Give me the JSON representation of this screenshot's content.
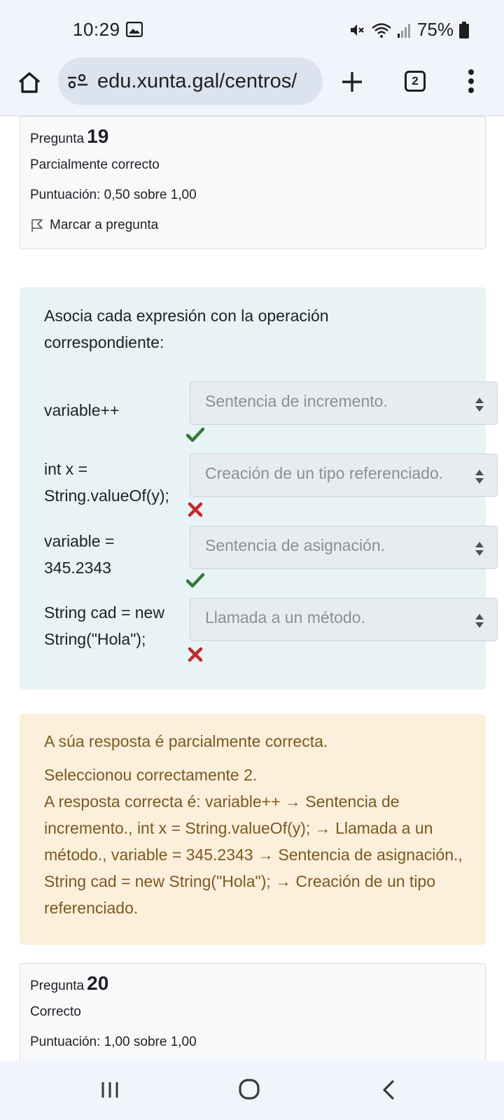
{
  "status_bar": {
    "time": "10:29",
    "battery": "75%",
    "icons": [
      "photo-icon",
      "mute-icon",
      "wifi-icon",
      "signal-icon",
      "battery-icon"
    ]
  },
  "browser": {
    "url": "edu.xunta.gal/centros/",
    "tab_count": "2",
    "icons": [
      "home-icon",
      "site-settings-icon",
      "plus-icon",
      "tabs-icon",
      "overflow-menu-icon"
    ]
  },
  "question19": {
    "label": "Pregunta",
    "number": "19",
    "state": "Parcialmente correcto",
    "grade": "Puntuación: 0,50 sobre 1,00",
    "flag_label": "Marcar a pregunta",
    "text_line1": "Asocia cada expresión con la operación",
    "text_line2": "correspondiente:",
    "matches": [
      {
        "line1": "variable++",
        "line2": "",
        "answer": "Sentencia de incremento.",
        "correct": true
      },
      {
        "line1": "int x =",
        "line2": "String.valueOf(y);",
        "answer": "Creación de un tipo referenciado.",
        "correct": false
      },
      {
        "line1": "variable =",
        "line2": "345.2343",
        "answer": "Sentencia de asignación.",
        "correct": true
      },
      {
        "line1": "String cad = new",
        "line2": "String(\"Hola\");",
        "answer": "Llamada a un método.",
        "correct": false
      }
    ],
    "feedback": {
      "general": "A súa resposta é parcialmente correcta.",
      "num_correct": "Seleccionou correctamente 2.",
      "right_answer": "A resposta correcta é: variable++ → Sentencia de incremento., int x = String.valueOf(y); → Llamada a un método., variable = 345.2343 → Sentencia de asignación., String cad = new String(\"Hola\"); → Creación de un tipo referenciado."
    }
  },
  "question20": {
    "label": "Pregunta",
    "number": "20",
    "state": "Correcto",
    "grade": "Puntuación: 1,00 sobre 1,00"
  },
  "colors": {
    "correct": "#2e7d32",
    "incorrect": "#c62828",
    "question_bg": "#e7f3f5",
    "feedback_bg": "#fcefdc",
    "feedback_text": "#7b5a1e"
  },
  "nav_bar": {
    "icons": [
      "recent-apps-icon",
      "home-circle-icon",
      "back-icon"
    ]
  }
}
